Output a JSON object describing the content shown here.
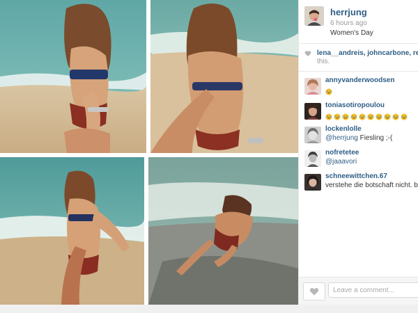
{
  "post": {
    "username": "herrjung",
    "time": "6 hours ago",
    "caption": "Women's Day"
  },
  "likes": {
    "names": "lena__andreis, johncarbone, renaa",
    "tail": "this."
  },
  "comments": [
    {
      "user": "annyvanderwoodsen",
      "text": "",
      "emoji_count": 1
    },
    {
      "user": "toniasotiropoulou",
      "text": "",
      "emoji_count": 10
    },
    {
      "user": "lockenlolle",
      "mention": "@herrjung",
      "text": " Fiesling ;-("
    },
    {
      "user": "nofretetee",
      "mention": "@jaaavori",
      "text": ""
    },
    {
      "user": "schneewittchen.67",
      "text": "verstehe die botschaft nicht. bi"
    }
  ],
  "footer": {
    "comment_placeholder": "Leave a comment..."
  },
  "icons": {
    "like": "heart-icon",
    "likes_indicator": "heart-icon",
    "emoji": "crying-laughing-emoji-icon"
  },
  "colors": {
    "link": "#2e5e86",
    "muted": "#9a9a9a",
    "text": "#333333"
  }
}
